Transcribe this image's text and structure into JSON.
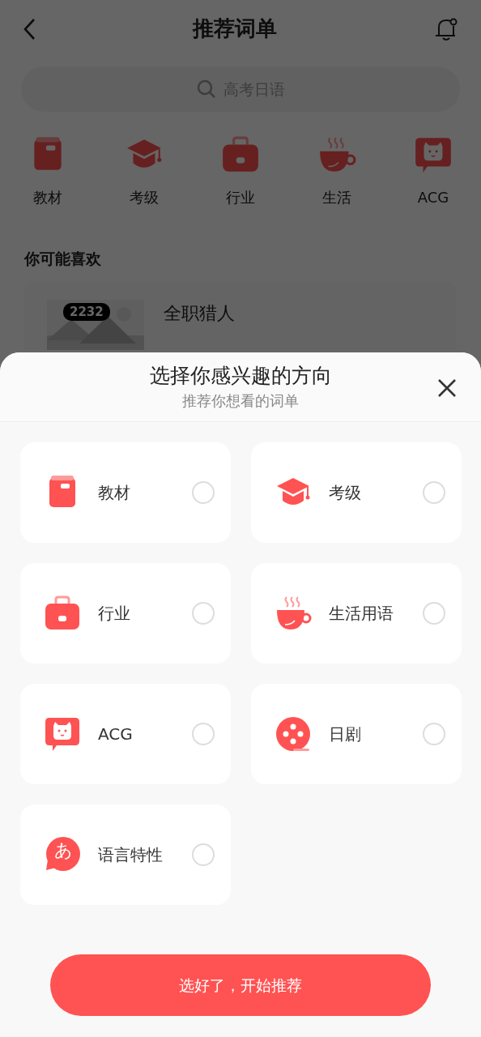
{
  "header": {
    "title": "推荐词单"
  },
  "search": {
    "placeholder": "高考日语"
  },
  "categories": [
    {
      "label": "教材",
      "kind": "book"
    },
    {
      "label": "考级",
      "kind": "cap"
    },
    {
      "label": "行业",
      "kind": "bag"
    },
    {
      "label": "生活",
      "kind": "cup"
    },
    {
      "label": "ACG",
      "kind": "cat"
    }
  ],
  "section_title": "你可能喜欢",
  "featured": {
    "title": "全职猎人",
    "views": "2232"
  },
  "sheet": {
    "title": "选择你感兴趣的方向",
    "subtitle": "推荐你想看的词单",
    "options": [
      {
        "label": "教材",
        "kind": "book",
        "selected": false
      },
      {
        "label": "考级",
        "kind": "cap",
        "selected": false
      },
      {
        "label": "行业",
        "kind": "bag",
        "selected": false
      },
      {
        "label": "生活用语",
        "kind": "cup",
        "selected": false
      },
      {
        "label": "ACG",
        "kind": "cat",
        "selected": false
      },
      {
        "label": "日剧",
        "kind": "reel",
        "selected": false
      },
      {
        "label": "语言特性",
        "kind": "glyph",
        "glyph": "あ",
        "selected": false
      }
    ],
    "confirm": "选好了，开始推荐"
  }
}
